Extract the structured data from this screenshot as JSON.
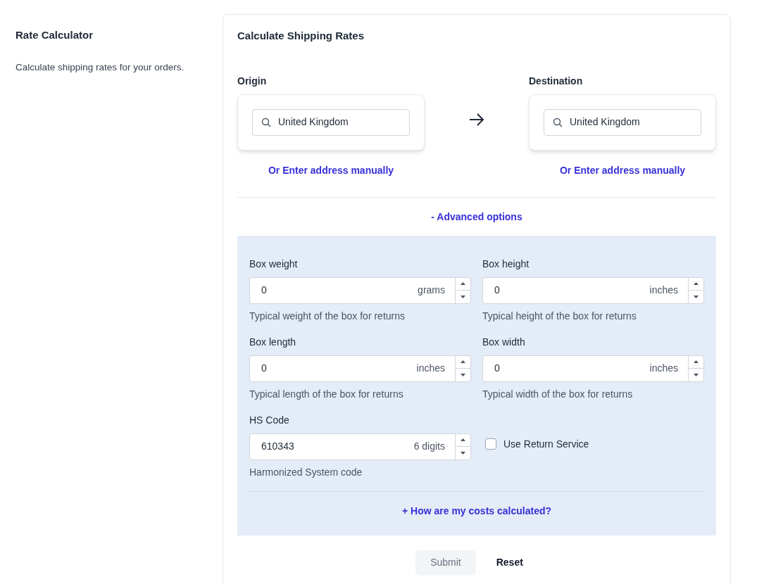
{
  "sidebar": {
    "title": "Rate Calculator",
    "description": "Calculate shipping rates for your orders."
  },
  "card": {
    "title": "Calculate Shipping Rates",
    "locations": [
      {
        "label": "Origin",
        "value": "United Kingdom",
        "link": "Or Enter address manually"
      },
      {
        "label": "Destination",
        "value": "United Kingdom",
        "link": "Or Enter address manually"
      }
    ],
    "advanced_toggle": "- Advanced options",
    "fields": [
      {
        "kind": "number",
        "label": "Box weight",
        "value": "0",
        "unit": "grams",
        "help": "Typical weight of the box for returns"
      },
      {
        "kind": "number",
        "label": "Box height",
        "value": "0",
        "unit": "inches",
        "help": "Typical height of the box for returns"
      },
      {
        "kind": "number",
        "label": "Box length",
        "value": "0",
        "unit": "inches",
        "help": "Typical length of the box for returns"
      },
      {
        "kind": "number",
        "label": "Box width",
        "value": "0",
        "unit": "inches",
        "help": "Typical width of the box for returns"
      },
      {
        "kind": "number",
        "label": "HS Code",
        "value": "610343",
        "unit": "6 digits",
        "help": "Harmonized System code"
      },
      {
        "kind": "checkbox",
        "label": "Use Return Service",
        "checked": false
      }
    ],
    "costs_link": "+ How are my costs calculated?",
    "buttons": [
      {
        "label": "Submit",
        "kind": "primary",
        "disabled": true
      },
      {
        "label": "Reset",
        "kind": "plain",
        "disabled": false
      }
    ]
  }
}
